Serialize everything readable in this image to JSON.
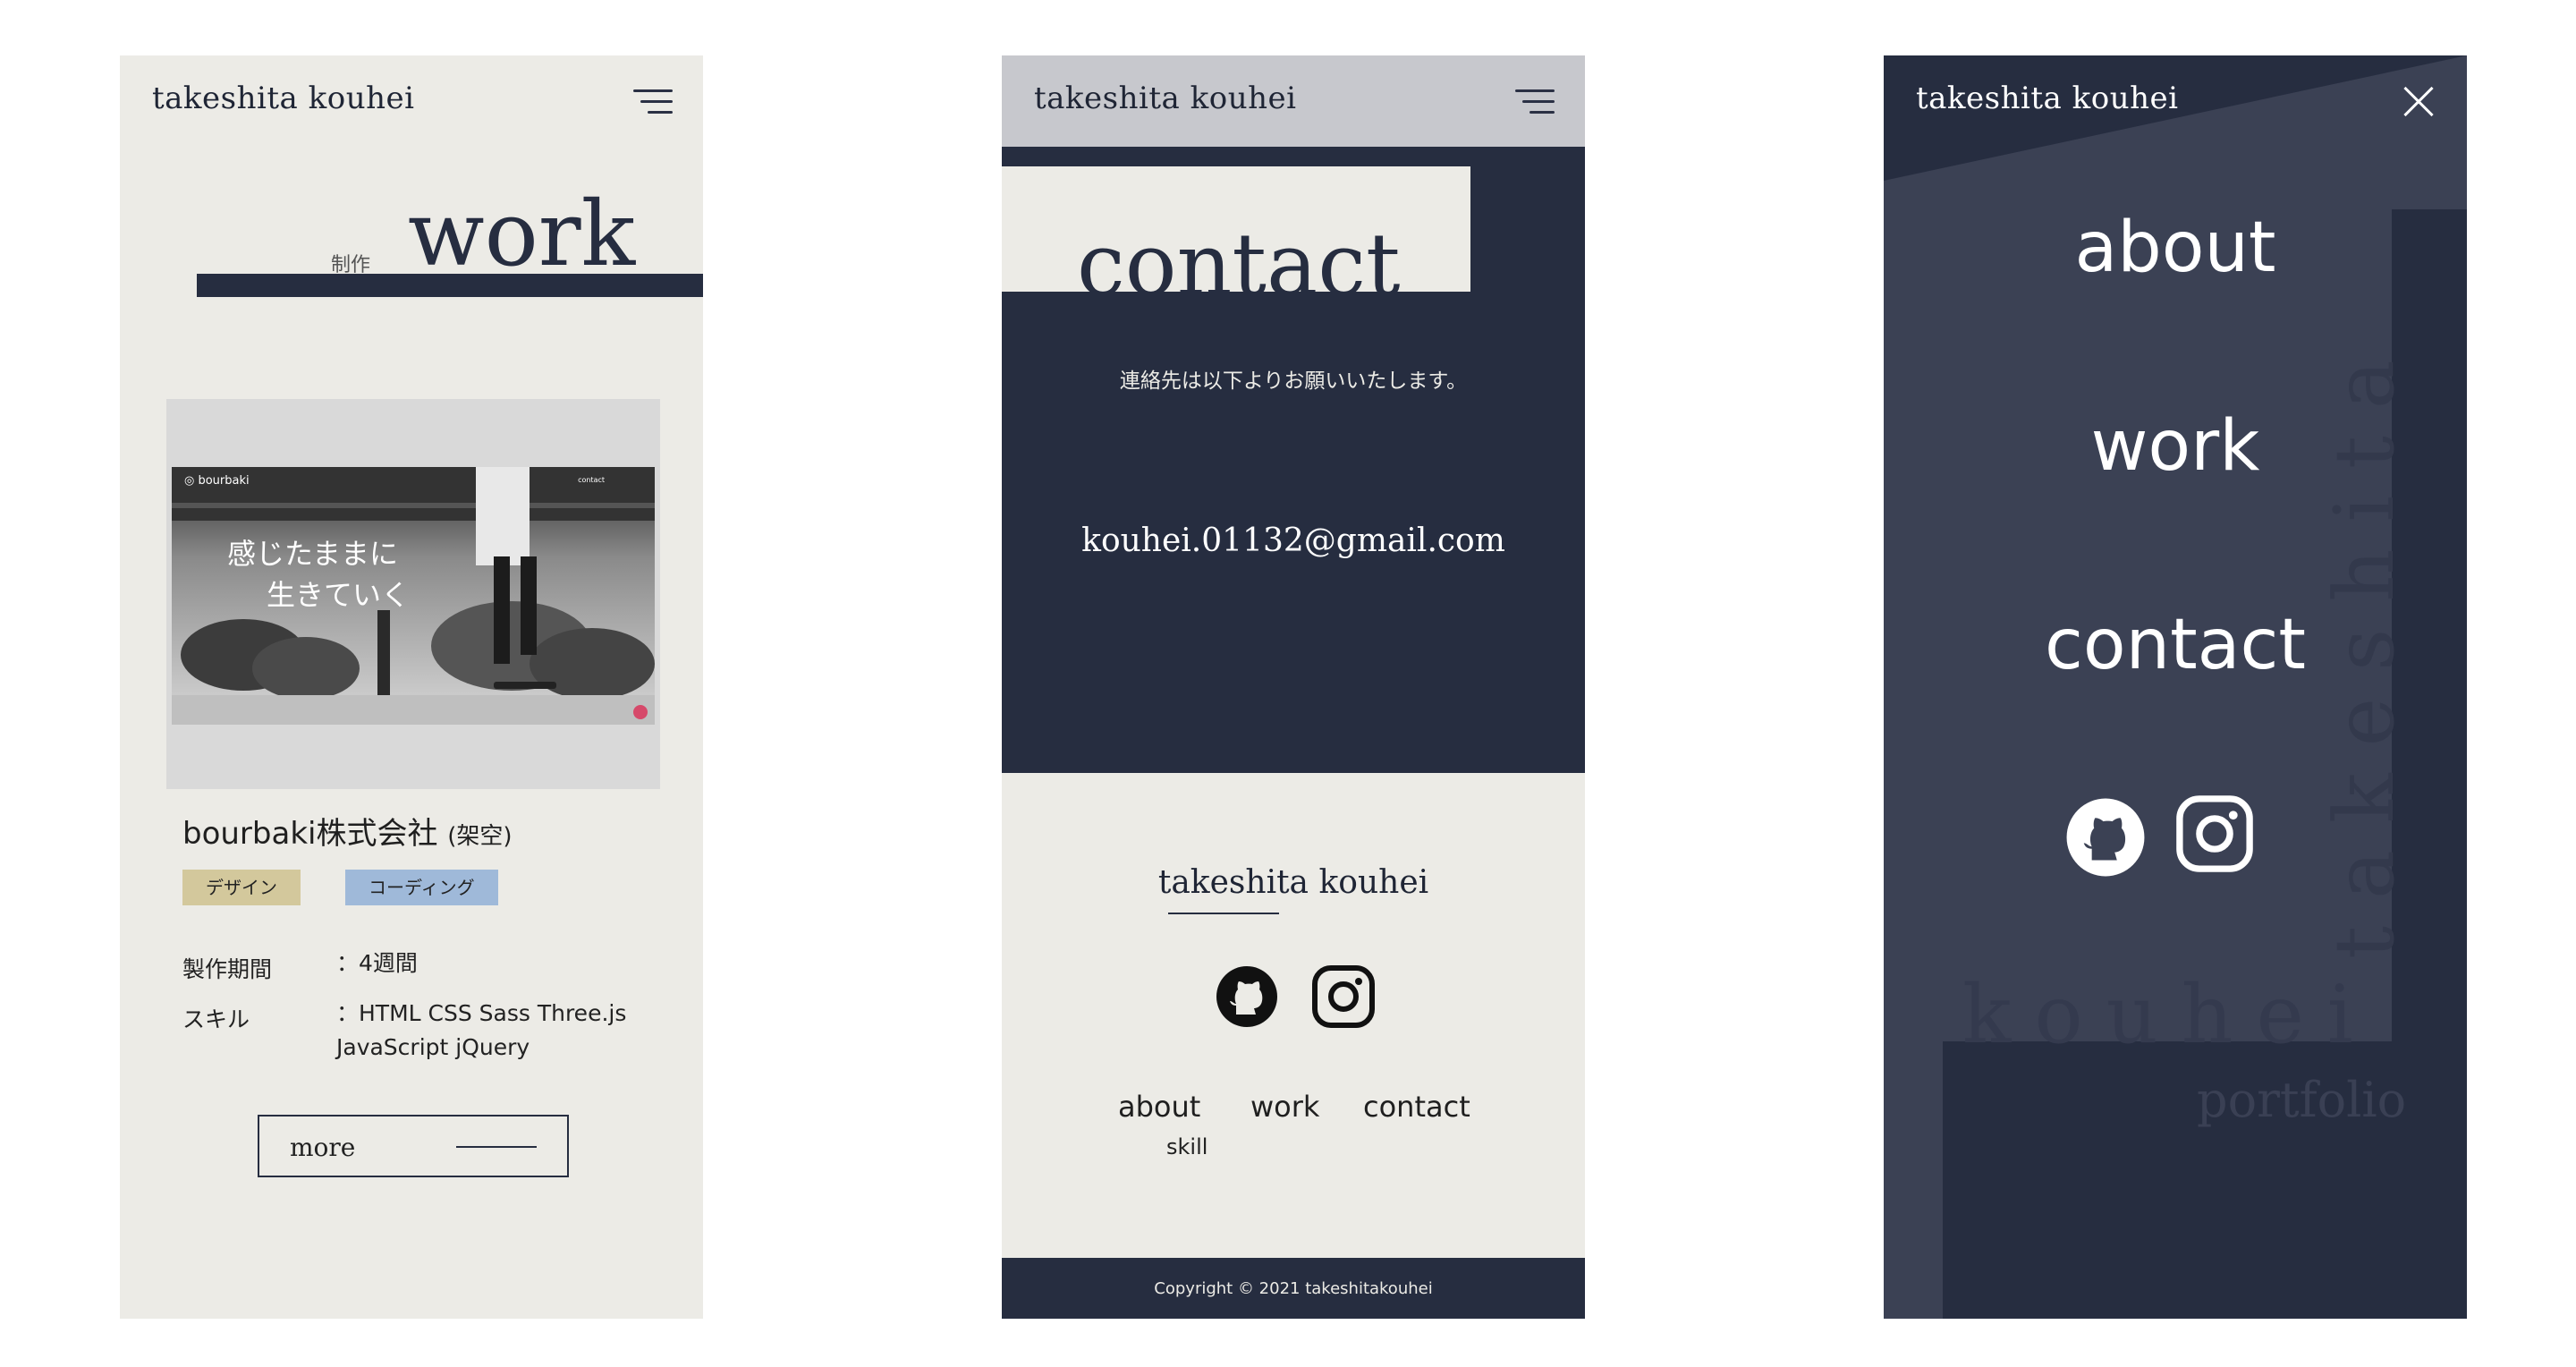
{
  "site_name": "takeshita kouhei",
  "work_page": {
    "heading": "work",
    "heading_sub": "制作",
    "thumbnail": {
      "brand": "◎ bourbaki",
      "nav_label": "contact",
      "copy_line1": "感じたままに",
      "copy_line2": "生きていく"
    },
    "company": "bourbaki株式会社",
    "company_note": "(架空)",
    "tags": [
      "デザイン",
      "コーディング"
    ],
    "period_label": "製作期間",
    "period_value": "：4週間",
    "skill_label": "スキル",
    "skill_value": "：HTML CSS Sass Three.js JavaScript jQuery",
    "more_label": "more"
  },
  "contact_page": {
    "heading": "contact",
    "message": "連絡先は以下よりお願いいたします。",
    "email": "kouhei.01132@gmail.com",
    "footer_name": "takeshita kouhei",
    "footer_nav": [
      "about",
      "work",
      "contact"
    ],
    "footer_sub": "skill",
    "copyright": "Copyright © 2021 takeshitakouhei"
  },
  "menu_page": {
    "links": [
      "about",
      "work",
      "contact"
    ],
    "deco_vertical": "takeshita",
    "deco_horizontal": "kouhei",
    "deco_portfolio": "portfolio"
  },
  "colors": {
    "navy": "#262d40",
    "cream": "#ecebe6",
    "tag_design": "#d3c89c",
    "tag_coding": "#9fb9d9"
  },
  "icons": [
    "menu-icon",
    "close-icon",
    "github-icon",
    "instagram-icon"
  ]
}
